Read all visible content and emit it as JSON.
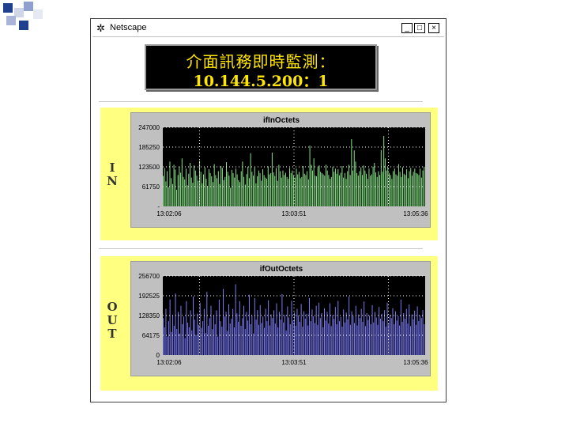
{
  "window": {
    "title": "Netscape",
    "minimize": "_",
    "maximize": "□",
    "close": "×"
  },
  "header": {
    "line1": "介面訊務即時監測：",
    "line2": "10.144.5.200：1"
  },
  "side_labels": {
    "in": [
      "I",
      "N"
    ],
    "out": [
      "O",
      "U",
      "T"
    ]
  },
  "colors": {
    "panel_bg": "#ffff80",
    "plot_bg": "#000000",
    "in_bars": "#90ee90",
    "out_bars": "#8080ff",
    "header_text": "#ffe600"
  },
  "chart_data": [
    {
      "type": "bar",
      "title": "ifInOctets",
      "yticks": [
        "247000",
        "185250",
        "123500",
        "61750",
        "-"
      ],
      "ylim": [
        0,
        247000
      ],
      "xticks": [
        "13:02:06",
        "13:03:51",
        "13:05:36"
      ],
      "color": "#90ee90",
      "values": [
        95000,
        120000,
        78000,
        110000,
        60000,
        140000,
        88000,
        70000,
        130000,
        115000,
        52000,
        98000,
        125000,
        105000,
        150000,
        92000,
        84000,
        118000,
        66000,
        102000,
        136000,
        90000,
        74000,
        128000,
        112000,
        96000,
        80000,
        143000,
        108000,
        72000,
        100000,
        122000,
        86000,
        64000,
        116000,
        104000,
        94000,
        76000,
        132000,
        98000,
        88000,
        110000,
        70000,
        126000,
        120000,
        82000,
        92000,
        138000,
        108000,
        96000,
        58000,
        114000,
        104000,
        90000,
        118000,
        100000,
        82000,
        76000,
        110000,
        140000,
        92000,
        68000,
        101000,
        124000,
        88000,
        166000,
        108000,
        96000,
        122000,
        72000,
        94000,
        112000,
        104000,
        80000,
        116000,
        98000,
        90000,
        86000,
        125000,
        100000,
        104000,
        168000,
        106000,
        95000,
        120000,
        80000,
        130000,
        110000,
        90000,
        112000,
        98000,
        105000,
        92000,
        86000,
        120000,
        104000,
        112000,
        96000,
        90000,
        118000,
        100000,
        108000,
        88000,
        92000,
        126000,
        102000,
        98000,
        110000,
        84000,
        190000,
        130000,
        112000,
        150000,
        96000,
        94000,
        122000,
        128000,
        108000,
        104000,
        100000,
        96000,
        130000,
        112000,
        98000,
        86000,
        92000,
        124000,
        108000,
        118000,
        102000,
        116000,
        97000,
        105000,
        126000,
        90000,
        104000,
        86000,
        110000,
        130000,
        98000,
        210000,
        112000,
        175000,
        140000,
        104000,
        96000,
        110000,
        122000,
        98000,
        128000,
        112000,
        102000,
        86000,
        118000,
        96000,
        100000,
        124000,
        136000,
        106000,
        92000,
        110000,
        98000,
        176000,
        108000,
        220000,
        150000,
        112000,
        122000,
        104000,
        98000,
        86000,
        110000,
        118000,
        100000,
        96000,
        132000,
        108000,
        92000,
        122000,
        102000,
        98000,
        116000,
        88000,
        110000,
        120000,
        96000,
        108000,
        118000,
        104000,
        102000,
        98000,
        118000,
        90000,
        112000,
        124000
      ]
    },
    {
      "type": "bar",
      "title": "ifOutOctets",
      "yticks": [
        "256700",
        "192525",
        "128350",
        "64175",
        "0"
      ],
      "ylim": [
        0,
        256700
      ],
      "xticks": [
        "13:02:06",
        "13:03:51",
        "13:05:36"
      ],
      "color": "#8080ff",
      "values": [
        120000,
        90000,
        150000,
        60000,
        110000,
        180000,
        75000,
        130000,
        95000,
        200000,
        85000,
        140000,
        70000,
        160000,
        100000,
        125000,
        55000,
        175000,
        105000,
        90000,
        145000,
        80000,
        190000,
        115000,
        65000,
        135000,
        98000,
        170000,
        88000,
        110000,
        150000,
        72000,
        205000,
        95000,
        120000,
        160000,
        84000,
        130000,
        100000,
        145000,
        60000,
        180000,
        110000,
        92000,
        215000,
        125000,
        140000,
        78000,
        165000,
        102000,
        118000,
        150000,
        90000,
        230000,
        135000,
        108000,
        175000,
        95000,
        120000,
        160000,
        85000,
        140000,
        112000,
        196000,
        100000,
        128000,
        70000,
        185000,
        115000,
        146000,
        98000,
        162000,
        104000,
        125000,
        88000,
        150000,
        110000,
        178000,
        96000,
        132000,
        120000,
        145000,
        102000,
        168000,
        90000,
        140000,
        115000,
        198000,
        106000,
        130000,
        80000,
        158000,
        122000,
        100000,
        176000,
        112000,
        138000,
        95000,
        150000,
        128000,
        108000,
        166000,
        92000,
        142000,
        118000,
        134000,
        96000,
        185000,
        110000,
        148000,
        126000,
        104000,
        160000,
        98000,
        170000,
        120000,
        136000,
        90000,
        152000,
        112000,
        140000,
        102000,
        168000,
        94000,
        130000,
        118000,
        156000,
        100000,
        176000,
        110000,
        124000,
        92000,
        148000,
        106000,
        138000,
        116000,
        190000,
        98000,
        142000,
        126000,
        104000,
        160000,
        96000,
        132000,
        120000,
        150000,
        108000,
        174000,
        94000,
        136000,
        114000,
        128000,
        100000,
        162000,
        106000,
        140000,
        122000,
        98000,
        156000,
        118000,
        134000,
        110000,
        146000,
        92000,
        170000,
        104000,
        130000,
        120000,
        152000,
        100000,
        142000,
        112000,
        126000,
        96000,
        180000,
        108000,
        136000,
        118000,
        150000,
        102000,
        164000,
        94000,
        132000,
        116000,
        144000,
        98000,
        158000,
        110000,
        128000,
        120000,
        146000,
        100000
      ]
    }
  ]
}
